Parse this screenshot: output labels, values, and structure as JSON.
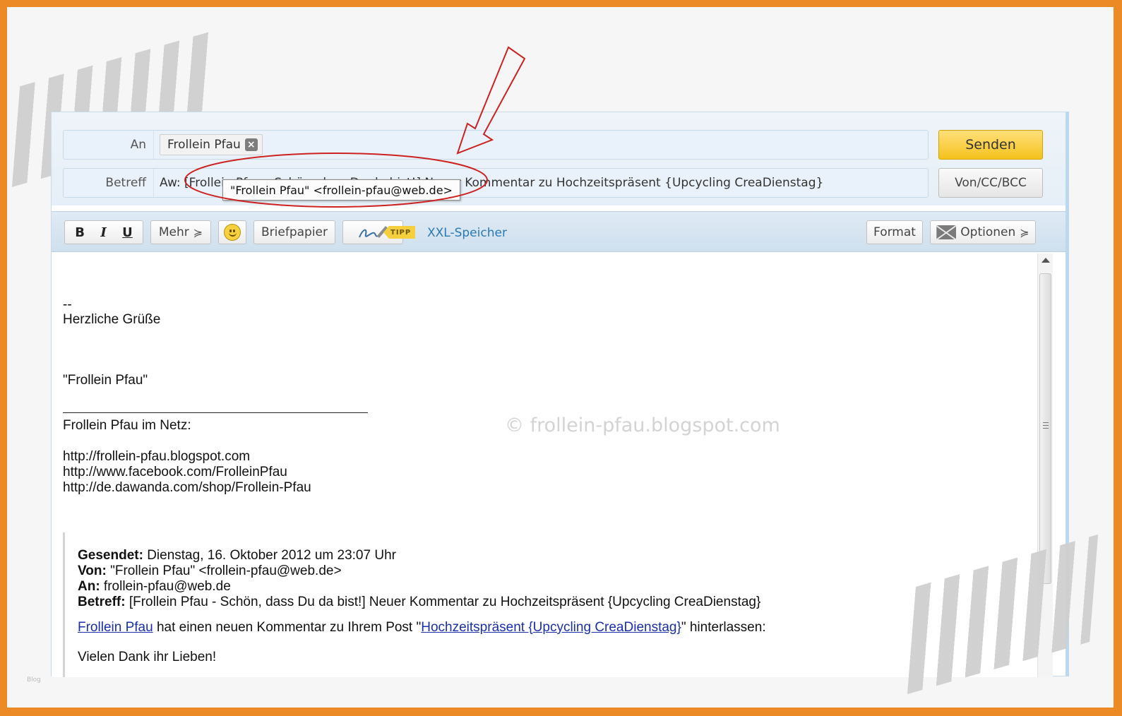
{
  "header": {
    "to_label": "An",
    "recipient_chip": "Frollein Pfau",
    "subject_label": "Betreff",
    "subject_value": "Aw: [Frollein Pfau - Schön, dass Du da bist!] Neuer Kommentar zu Hochzeitspräsent {Upcycling CreaDienstag}",
    "send_label": "Senden",
    "cc_label": "Von/CC/BCC",
    "tooltip": "\"Frollein Pfau\" <frollein-pfau@web.de>"
  },
  "toolbar": {
    "bold": "B",
    "italic": "I",
    "underline": "U",
    "more_label": "Mehr",
    "stationery_label": "Briefpapier",
    "tip_badge": "TIPP",
    "xxl_link": "XXL-Speicher",
    "format_label": "Format",
    "options_label": "Optionen"
  },
  "body": {
    "sig_dashes": "--",
    "greeting": "Herzliche Grüße",
    "sender_name": "\"Frollein Pfau\"",
    "web_heading": "Frollein Pfau im Netz:",
    "links": [
      "http://frollein-pfau.blogspot.com",
      "http://www.facebook.com/FrolleinPfau",
      "http://de.dawanda.com/shop/Frollein-Pfau"
    ],
    "watermark": "© frollein-pfau.blogspot.com"
  },
  "quote": {
    "sent_label": "Gesendet:",
    "sent_value": " Dienstag, 16. Oktober 2012 um 23:07 Uhr",
    "from_label": "Von:",
    "from_value": " \"Frollein Pfau\" <frollein-pfau@web.de>",
    "to_label": "An:",
    "to_value": " frollein-pfau@web.de",
    "subject_label": "Betreff:",
    "subject_value": " [Frollein Pfau - Schön, dass Du da bist!] Neuer Kommentar zu Hochzeitspräsent {Upcycling CreaDienstag}",
    "author_link": "Frollein Pfau",
    "comment_mid": " hat einen neuen Kommentar zu Ihrem Post \"",
    "post_link": "Hochzeitspräsent {Upcycling CreaDienstag}",
    "comment_end": "\" hinterlassen:",
    "thanks": "Vielen Dank ihr Lieben!"
  },
  "corner_mark": "Blog",
  "colors": {
    "frame_border": "#ec8a26",
    "send_button": "#f5c21c",
    "annotation_red": "#cc2222",
    "link": "#1a2fa8"
  },
  "icons": [
    "close-icon",
    "smiley-icon",
    "signature-pen-icon",
    "envelope-icon",
    "chevron-down-icon",
    "scroll-up-icon"
  ]
}
